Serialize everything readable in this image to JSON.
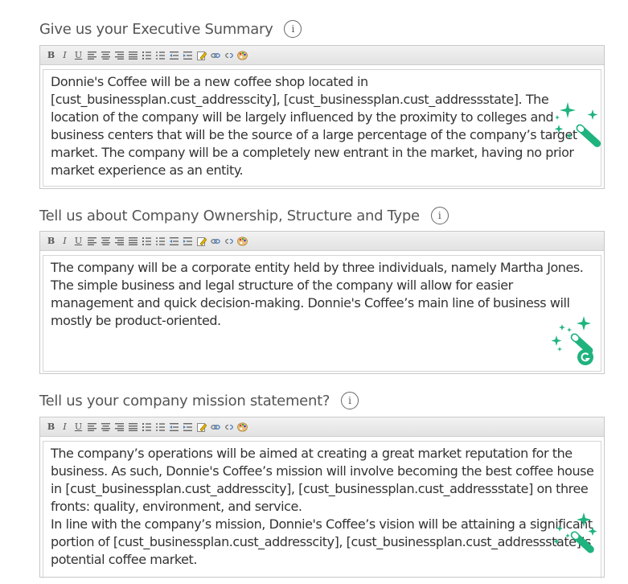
{
  "fields": [
    {
      "label": "Give us your Executive Summary",
      "paragraphs": [
        "Donnie's Coffee will be a new coffee shop located in [cust_businessplan.cust_addresscity], [cust_businessplan.cust_addressstate]. The location of the company will be largely influenced by the proximity to colleges and business centers that will be the source of a large percentage of the company’s target market. The company will be a completely new entrant in the market, having no prior market experience as an entity."
      ]
    },
    {
      "label": "Tell us about Company Ownership, Structure and Type",
      "paragraphs": [
        "The company will be a corporate entity held by three individuals, namely Martha Jones. The simple business and legal structure of the company will allow for easier management and quick decision-making. Donnie's Coffee’s main line of business will mostly be product-oriented."
      ]
    },
    {
      "label": "Tell us your company mission statement?",
      "paragraphs": [
        "The company’s operations will be aimed at creating a great market reputation for the business. As such, Donnie's Coffee’s mission will involve becoming the best coffee house in [cust_businessplan.cust_addresscity], [cust_businessplan.cust_addressstate] on three fronts: quality, environment, and service.",
        "In line with the company’s mission, Donnie's Coffee’s vision will be attaining a significant portion of [cust_businessplan.cust_addresscity], [cust_businessplan.cust_addressstate]’s potential coffee market."
      ]
    }
  ],
  "info_glyph": "i",
  "toolbar": {
    "bold": "B",
    "italic": "I",
    "underline": "U"
  },
  "icons": {
    "wand": "magic-wand-icon",
    "info": "info-icon",
    "grammarly_badge": "grammarly-icon"
  },
  "colors": {
    "wand_green": "#1fb37e",
    "label": "#555555",
    "border": "#c8c8c8"
  }
}
